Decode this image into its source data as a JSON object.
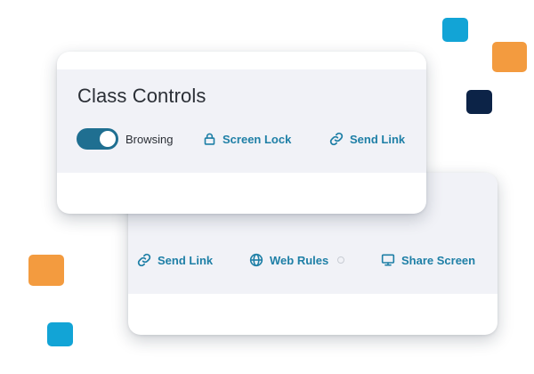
{
  "colors": {
    "accent": "#1e7fa6",
    "toggle_on": "#1f6f91",
    "deco_cyan": "#12a4d6",
    "deco_orange": "#f39b3f",
    "deco_navy": "#0c2347"
  },
  "front_card": {
    "title": "Class Controls",
    "browsing_toggle": {
      "label": "Browsing",
      "state": "on"
    },
    "screen_lock": {
      "label": "Screen Lock",
      "icon": "lock-icon"
    },
    "send_link": {
      "label": "Send Link",
      "icon": "link-icon"
    }
  },
  "back_card": {
    "send_link": {
      "label": "Send Link",
      "icon": "link-icon"
    },
    "web_rules": {
      "label": "Web Rules",
      "icon": "globe-icon",
      "status": "inactive"
    },
    "share_screen": {
      "label": "Share Screen",
      "icon": "monitor-icon"
    }
  }
}
